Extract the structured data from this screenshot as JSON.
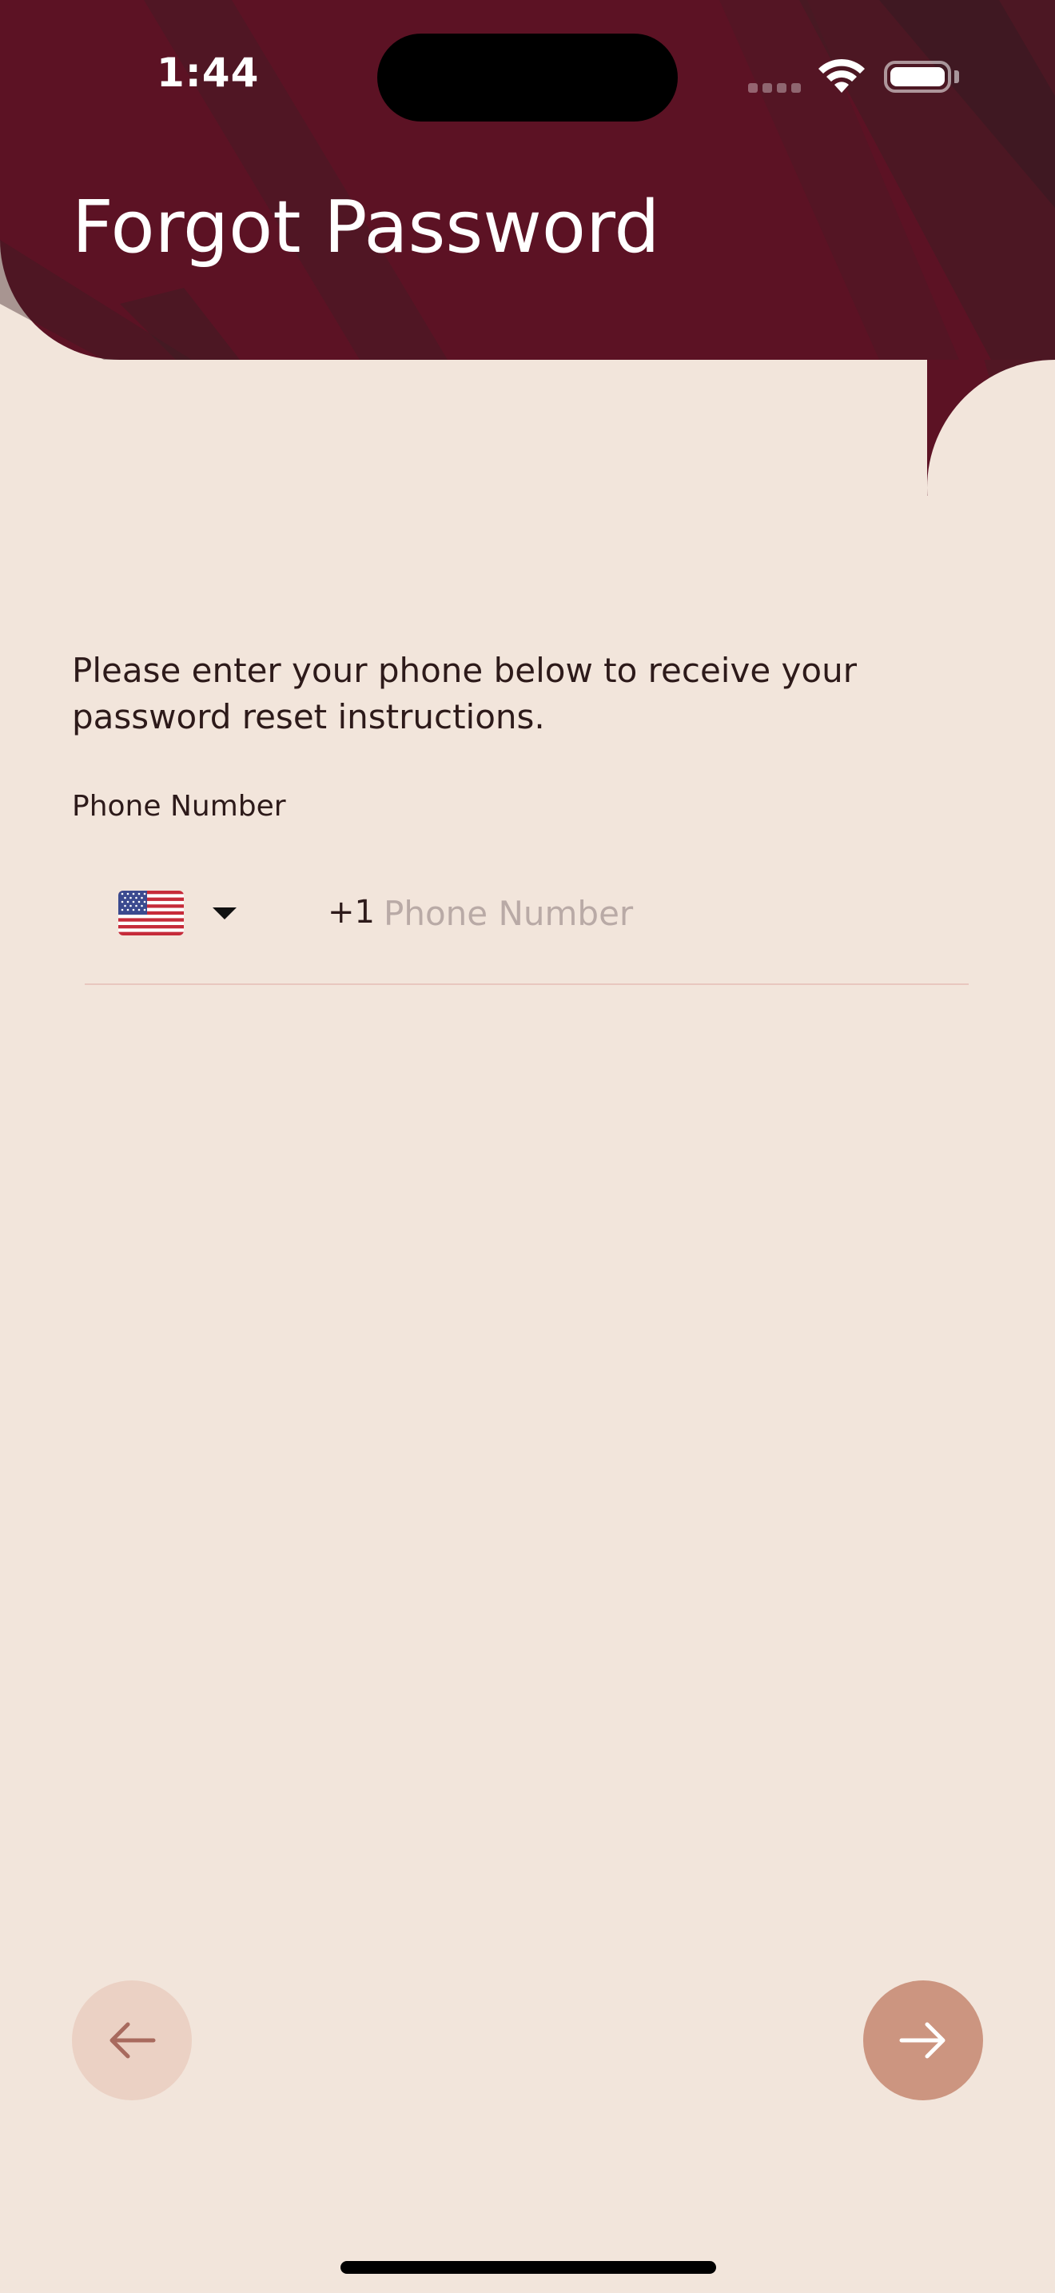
{
  "status_bar": {
    "time": "1:44"
  },
  "header": {
    "title": "Forgot Password",
    "background_color": "#5c1224"
  },
  "form": {
    "instructions": "Please enter your phone below to receive your password reset instructions.",
    "phone_label": "Phone Number",
    "country": {
      "flag_icon": "us-flag-icon",
      "dial_code": "+1"
    },
    "phone_input": {
      "value": "",
      "placeholder": "Phone Number"
    }
  },
  "navigation": {
    "back_icon": "arrow-left-icon",
    "next_icon": "arrow-right-icon",
    "back_color": "#ebd1c4",
    "next_color": "#cc9580"
  }
}
